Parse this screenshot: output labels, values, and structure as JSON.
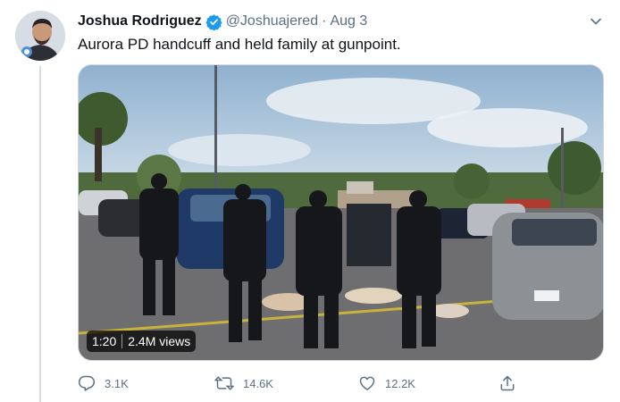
{
  "tweet": {
    "author_name": "Joshua Rodriguez",
    "handle": "@Joshuajered",
    "separator": "·",
    "date": "Aug 3",
    "text": "Aurora PD handcuff and held family at gunpoint."
  },
  "video": {
    "duration": "1:20",
    "views": "2.4M views"
  },
  "actions": {
    "reply_count": "3.1K",
    "retweet_count": "14.6K",
    "like_count": "12.2K"
  },
  "colors": {
    "verified": "#1d9bf0",
    "secondary_text": "#5b7083",
    "thread_line": "#d7dde3"
  },
  "icons": {
    "verified": "verified-badge-icon",
    "menu": "chevron-down-icon",
    "reply": "reply-icon",
    "retweet": "retweet-icon",
    "like": "heart-icon",
    "share": "share-icon"
  }
}
